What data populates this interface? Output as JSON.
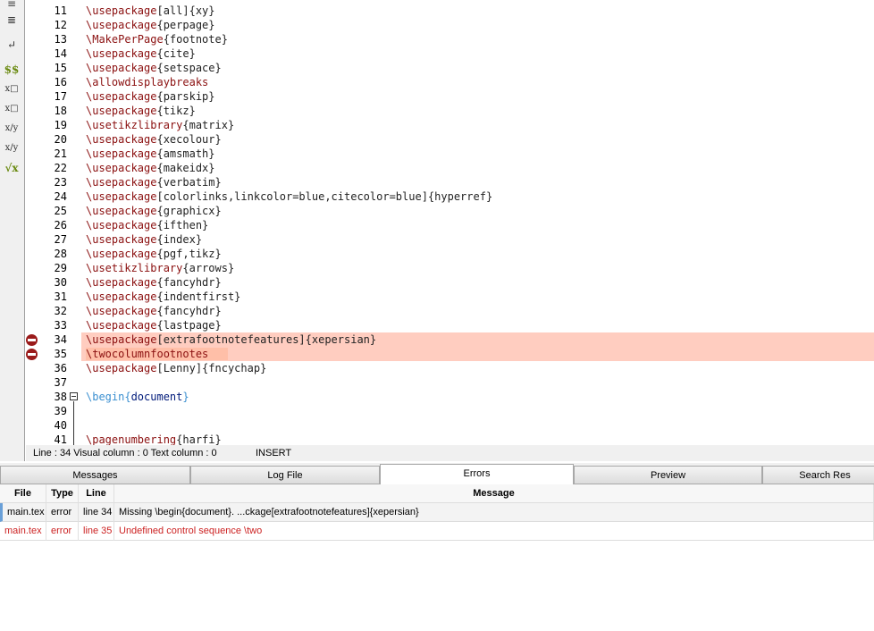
{
  "toolbar": {
    "icons": [
      "align-right-icon",
      "align-justify-icon",
      "newline-icon",
      "inline-math-icon",
      "subscript-icon",
      "superscript-icon",
      "fraction-icon",
      "dfrac-icon",
      "sqrt-icon"
    ],
    "glyphs": [
      "≡",
      "≣",
      "↵",
      "$$",
      "x□",
      "x□",
      "x/y",
      "x/y",
      "√x"
    ]
  },
  "editor": {
    "lines": [
      {
        "n": "11",
        "segs": [
          [
            "cmd",
            "\\usepackage"
          ],
          [
            "",
            "[all]{xy}"
          ]
        ]
      },
      {
        "n": "12",
        "segs": [
          [
            "cmd",
            "\\usepackage"
          ],
          [
            "",
            "{perpage}"
          ]
        ]
      },
      {
        "n": "13",
        "segs": [
          [
            "cmd",
            "\\MakePerPage"
          ],
          [
            "",
            "{footnote}"
          ]
        ]
      },
      {
        "n": "14",
        "segs": [
          [
            "cmd",
            "\\usepackage"
          ],
          [
            "",
            "{cite}"
          ]
        ]
      },
      {
        "n": "15",
        "segs": [
          [
            "cmd",
            "\\usepackage"
          ],
          [
            "",
            "{setspace}"
          ]
        ]
      },
      {
        "n": "16",
        "segs": [
          [
            "cmd",
            "\\allowdisplaybreaks"
          ]
        ]
      },
      {
        "n": "17",
        "segs": [
          [
            "cmd",
            "\\usepackage"
          ],
          [
            "",
            "{parskip}"
          ]
        ]
      },
      {
        "n": "18",
        "segs": [
          [
            "cmd",
            "\\usepackage"
          ],
          [
            "",
            "{tikz}"
          ]
        ]
      },
      {
        "n": "19",
        "segs": [
          [
            "cmd",
            "\\usetikzlibrary"
          ],
          [
            "",
            "{matrix}"
          ]
        ]
      },
      {
        "n": "20",
        "segs": [
          [
            "cmd",
            "\\usepackage"
          ],
          [
            "",
            "{xecolour}"
          ]
        ]
      },
      {
        "n": "21",
        "segs": [
          [
            "cmd",
            "\\usepackage"
          ],
          [
            "",
            "{amsmath}"
          ]
        ]
      },
      {
        "n": "22",
        "segs": [
          [
            "cmd",
            "\\usepackage"
          ],
          [
            "",
            "{makeidx}"
          ]
        ]
      },
      {
        "n": "23",
        "segs": [
          [
            "cmd",
            "\\usepackage"
          ],
          [
            "",
            "{verbatim}"
          ]
        ]
      },
      {
        "n": "24",
        "segs": [
          [
            "cmd",
            "\\usepackage"
          ],
          [
            "",
            "[colorlinks,linkcolor=blue,citecolor=blue]{hyperref}"
          ]
        ]
      },
      {
        "n": "25",
        "segs": [
          [
            "cmd",
            "\\usepackage"
          ],
          [
            "",
            "{graphicx}"
          ]
        ]
      },
      {
        "n": "26",
        "segs": [
          [
            "cmd",
            "\\usepackage"
          ],
          [
            "",
            "{ifthen}"
          ]
        ]
      },
      {
        "n": "27",
        "segs": [
          [
            "cmd",
            "\\usepackage"
          ],
          [
            "",
            "{index}"
          ]
        ]
      },
      {
        "n": "28",
        "segs": [
          [
            "cmd",
            "\\usepackage"
          ],
          [
            "",
            "{pgf,tikz}"
          ]
        ]
      },
      {
        "n": "29",
        "segs": [
          [
            "cmd",
            "\\usetikzlibrary"
          ],
          [
            "",
            "{arrows}"
          ]
        ]
      },
      {
        "n": "30",
        "segs": [
          [
            "cmd",
            "\\usepackage"
          ],
          [
            "",
            "{fancyhdr}"
          ]
        ]
      },
      {
        "n": "31",
        "segs": [
          [
            "cmd",
            "\\usepackage"
          ],
          [
            "",
            "{indentfirst}"
          ]
        ]
      },
      {
        "n": "32",
        "segs": [
          [
            "cmd",
            "\\usepackage"
          ],
          [
            "",
            "{fancyhdr}"
          ]
        ]
      },
      {
        "n": "33",
        "segs": [
          [
            "cmd",
            "\\usepackage"
          ],
          [
            "",
            "{lastpage}"
          ]
        ]
      },
      {
        "n": "34",
        "error": true,
        "segs": [
          [
            "cmd",
            "\\usepackage"
          ],
          [
            "",
            "[extrafootnotefeatures]{xepersian}"
          ]
        ]
      },
      {
        "n": "35",
        "error": true,
        "segs": [
          [
            "cmd",
            "\\twocolumnfootnotes"
          ]
        ]
      },
      {
        "n": "36",
        "segs": [
          [
            "cmd",
            "\\usepackage"
          ],
          [
            "",
            "[Lenny]{fncychap}"
          ]
        ]
      },
      {
        "n": "37",
        "segs": []
      },
      {
        "n": "38",
        "fold": true,
        "segs": [
          [
            "kw",
            "\\begin{"
          ],
          [
            "arg",
            "document"
          ],
          [
            "kw",
            "}"
          ]
        ]
      },
      {
        "n": "39",
        "segs": []
      },
      {
        "n": "40",
        "segs": []
      },
      {
        "n": "41",
        "segs": [
          [
            "cmd",
            "\\pagenumbering"
          ],
          [
            "",
            "{harfi}"
          ]
        ]
      }
    ]
  },
  "status": {
    "position": "Line : 34 Visual column : 0 Text column : 0",
    "mode": "INSERT"
  },
  "tabs": [
    "Messages",
    "Log File",
    "Errors",
    "Preview",
    "Search Res"
  ],
  "active_tab": "Errors",
  "errors": {
    "headers": {
      "file": "File",
      "type": "Type",
      "line": "Line",
      "message": "Message"
    },
    "rows": [
      {
        "file": "main.tex",
        "type": "error",
        "line": "line 34",
        "message": "Missing \\begin{document}. ...ckage[extrafootnotefeatures]{xepersian}"
      },
      {
        "file": "main.tex",
        "type": "error",
        "line": "line 35",
        "message": "Undefined control sequence \\two"
      }
    ]
  },
  "colors": {
    "error_highlight": "#ffcdc0",
    "error_text": "#cc2222",
    "command": "#8b1010"
  }
}
